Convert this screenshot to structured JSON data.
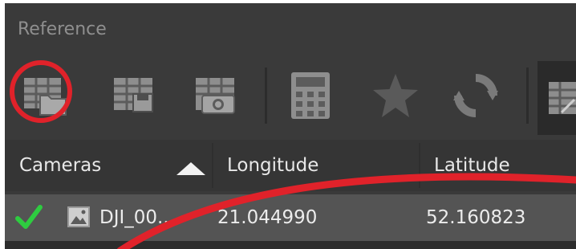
{
  "panel": {
    "title": "Reference"
  },
  "toolbar": {
    "buttons": [
      {
        "name": "import-reference-button",
        "icon": "table-folder-icon"
      },
      {
        "name": "export-reference-button",
        "icon": "table-save-icon"
      },
      {
        "name": "convert-reference-button",
        "icon": "table-camera-icon"
      },
      {
        "name": "calculator-button",
        "icon": "calculator-icon"
      },
      {
        "name": "optimize-button",
        "icon": "star-icon"
      },
      {
        "name": "update-button",
        "icon": "refresh-icon"
      },
      {
        "name": "settings-button",
        "icon": "table-edit-icon"
      }
    ]
  },
  "table": {
    "columns": [
      "Cameras",
      "Longitude",
      "Latitude"
    ],
    "sort_indicator": "ascending",
    "rows": [
      {
        "checked": true,
        "name": "DJI_00...",
        "longitude": "21.044990",
        "latitude": "52.160823"
      }
    ]
  },
  "colors": {
    "panel_bg": "#3a3a3a",
    "header_bg": "#353535",
    "row_bg": "#545454",
    "check_green": "#2ecc40",
    "annotation_red": "#e0222a"
  }
}
